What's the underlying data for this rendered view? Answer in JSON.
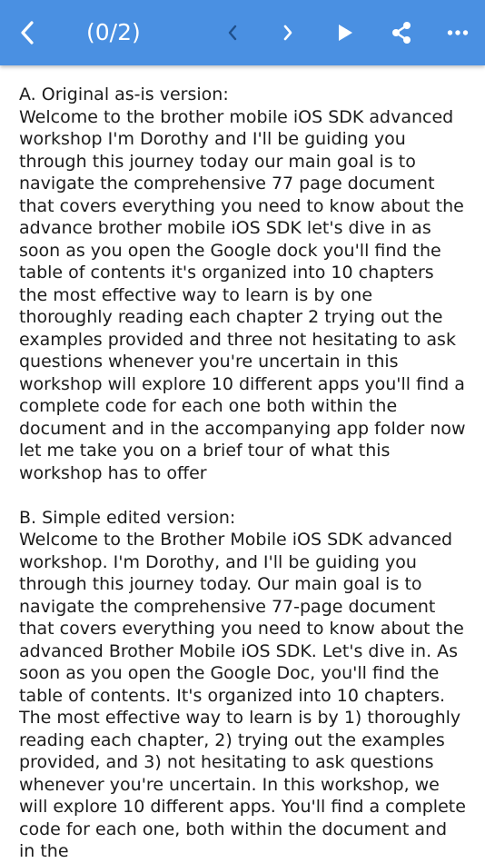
{
  "toolbar": {
    "title": "(0/2)",
    "icons": {
      "back": "chevron-left-icon",
      "prev": "chevron-left-small-icon",
      "next": "chevron-right-small-icon",
      "play": "play-icon",
      "share": "share-icon",
      "more": "more-horizontal-icon"
    },
    "color": "#4a90e2"
  },
  "content": {
    "sections": [
      {
        "heading": "A. Original as-is version:",
        "body": "Welcome to the brother mobile iOS SDK advanced workshop I'm Dorothy and I'll be guiding you through this journey today our main goal is to navigate the comprehensive 77 page document that covers everything you need to know about the advance brother mobile iOS SDK let's dive in as soon as you open the Google dock you'll find the table of contents it's organized into 10 chapters the most effective way to learn is by one thoroughly reading each chapter 2 trying out the examples provided and three not hesitating to ask questions whenever you're uncertain in this workshop will explore 10 different apps you'll find a complete code for each one both within the document and in the accompanying app folder now let me take you on a brief tour of what this workshop has to offer"
      },
      {
        "heading": "B. Simple edited version:",
        "body": "Welcome to the Brother Mobile iOS SDK advanced workshop. I'm Dorothy, and I'll be guiding you through this journey today. Our main goal is to navigate the comprehensive 77-page document that covers everything you need to know about the advanced Brother Mobile iOS SDK. Let's dive in. As soon as you open the Google Doc, you'll find the table of contents. It's organized into 10 chapters. The most effective way to learn is by 1) thoroughly reading each chapter, 2) trying out the examples provided, and 3) not hesitating to ask questions whenever you're uncertain. In this workshop, we will explore 10 different apps. You'll find a complete code for each one, both within the document and in the"
      }
    ]
  }
}
